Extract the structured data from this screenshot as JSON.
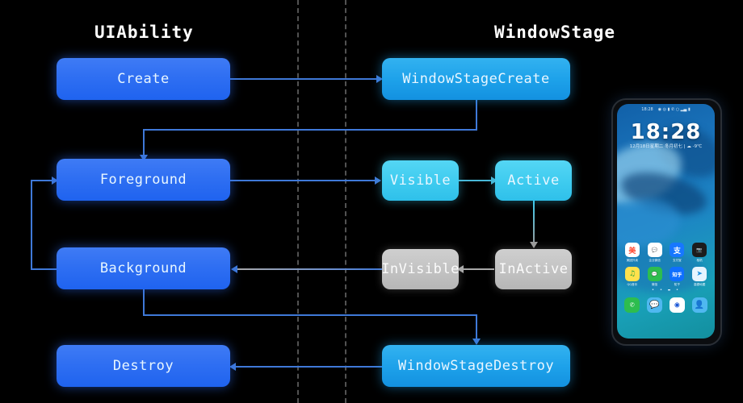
{
  "columns": [
    {
      "title": "UIAbility"
    },
    {
      "title": "WindowStage"
    }
  ],
  "nodes": {
    "create": "Create",
    "foreground": "Foreground",
    "background": "Background",
    "destroy": "Destroy",
    "window_stage_create": "WindowStageCreate",
    "visible": "Visible",
    "active": "Active",
    "invisible": "InVisible",
    "inactive": "InActive",
    "window_stage_destroy": "WindowStageDestroy"
  },
  "colors": {
    "background": "#000000",
    "node_blue": "#2f6ff2",
    "node_azure": "#1ea2ea",
    "node_cyan": "#3ecbef",
    "node_gray": "#c2c2c2",
    "arrow_blue": "#3f79d8",
    "arrow_cyan": "#49b8d8",
    "arrow_gray": "#a9a9a9",
    "divider": "#6e6e6e",
    "title_text": "#ffffff"
  },
  "phone": {
    "status_time": "18:28",
    "status_icons": "◉ ◎ ▮ ✆ ○ ▂▄ ▮",
    "clock": "18:28",
    "date_line": "12月18日星期二  冬月初七 | ☁ -9℃",
    "page_dots": "• • ▬ •",
    "apps": [
      {
        "label": "美团外卖",
        "glyph": "美",
        "bg": "#ffffff",
        "fg": "#ff4a33"
      },
      {
        "label": "企业微信",
        "glyph": "💬",
        "bg": "#ffffff",
        "fg": "#2d9cdb"
      },
      {
        "label": "支付宝",
        "glyph": "支",
        "bg": "#1777ff",
        "fg": "#ffffff"
      },
      {
        "label": "相机",
        "glyph": "📷",
        "bg": "#1c1c1c",
        "fg": "#ffffff"
      },
      {
        "label": "QQ音乐",
        "glyph": "♫",
        "bg": "#ffe14d",
        "fg": "#1a9e3c"
      },
      {
        "label": "微信",
        "glyph": "💬",
        "bg": "#2dbd4e",
        "fg": "#ffffff"
      },
      {
        "label": "知乎",
        "glyph": "知乎",
        "bg": "#0f6fff",
        "fg": "#ffffff"
      },
      {
        "label": "高德地图",
        "glyph": "➤",
        "bg": "#e8f4ff",
        "fg": "#1f8fe0"
      }
    ],
    "dock": [
      {
        "name": "phone-app",
        "glyph": "✆",
        "bg": "#2dbd4e"
      },
      {
        "name": "messages-app",
        "glyph": "💬",
        "bg": "#4fb8f0"
      },
      {
        "name": "browser-app",
        "glyph": "◉",
        "bg": "#ffffff"
      },
      {
        "name": "contacts-app",
        "glyph": "👤",
        "bg": "#4fb8f0"
      }
    ]
  }
}
